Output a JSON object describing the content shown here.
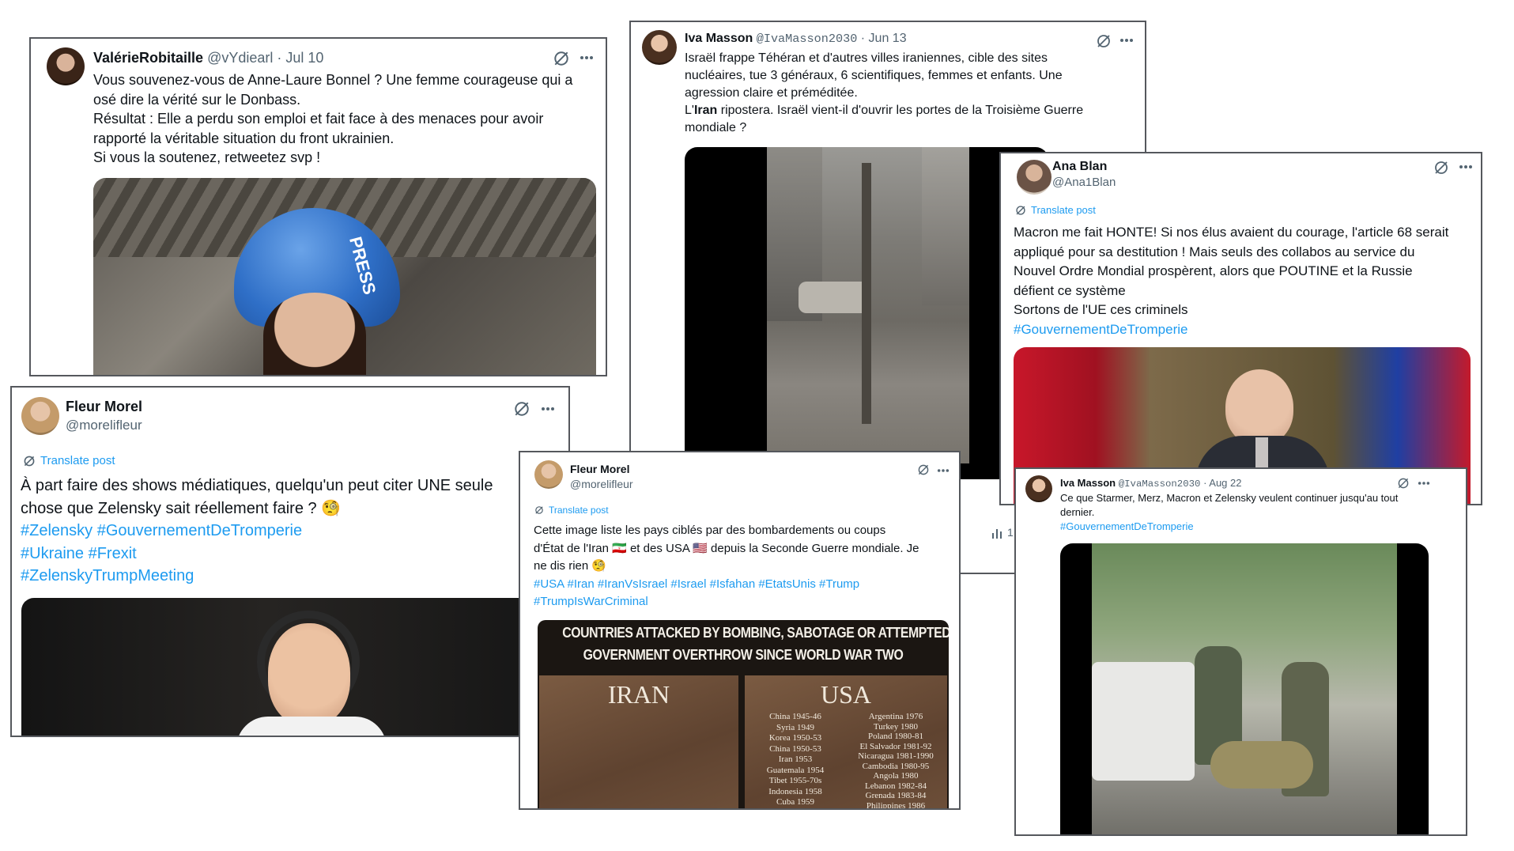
{
  "colors": {
    "link": "#1d9bf0",
    "muted": "#536471",
    "border": "#55585d"
  },
  "icons": {
    "grok": "grok-icon",
    "more": "more-icon",
    "translate": "translate-icon",
    "views": "views-icon"
  },
  "posts": [
    {
      "author": "ValérieRobitaille",
      "handle": "@vYdiearl",
      "date": "· Jul 10",
      "lines": [
        "Vous souvenez-vous de Anne-Laure Bonnel ?  Une femme courageuse qui a",
        "osé dire la vérité sur le Donbass.",
        "Résultat : Elle a perdu son emploi et fait face à des menaces pour avoir",
        "rapporté la véritable situation du front ukrainien.",
        "Si vous la soutenez, retweetez svp !"
      ],
      "media_text": "PRESS"
    },
    {
      "author": "Iva Masson",
      "handle": "@IvaMasson2030",
      "date": "· Jun 13",
      "lines": [
        "Israël frappe Téhéran et d'autres villes iraniennes, cible des sites",
        "nucléaires, tue 3 généraux, 6 scientifiques, femmes et enfants. Une",
        "agression claire et préméditée."
      ],
      "line4_prefix": "L'",
      "line4_bold": "Iran",
      "line4_rest": " ripostera. Israël vient-il d'ouvrir les portes de la Troisième Guerre",
      "line5": "mondiale ?",
      "views": "1"
    },
    {
      "author": "Ana Blan",
      "handle": "@Ana1Blan",
      "translate": "Translate post",
      "lines": [
        "Macron me fait HONTE! Si nos élus avaient du courage, l'article 68 serait",
        "appliqué pour sa destitution ! Mais seuls des collabos au service du",
        "Nouvel Ordre Mondial prospèrent, alors que POUTINE et la Russie",
        "défient ce système",
        "Sortons de l'UE ces criminels"
      ],
      "hashtags": "#GouvernementDeTromperie"
    },
    {
      "author": "Fleur Morel",
      "handle": "@morelifleur",
      "translate": "Translate post",
      "lines": [
        "À part faire des shows médiatiques, quelqu'un peut citer UNE seule",
        "chose que Zelensky sait réellement faire ? 🧐"
      ],
      "hashtag_lines": [
        "#Zelensky #GouvernementDeTromperie",
        "#Ukraine #Frexit",
        "#ZelenskyTrumpMeeting"
      ]
    },
    {
      "author": "Fleur Morel",
      "handle": "@morelifleur",
      "translate": "Translate post",
      "lines": [
        "Cette image liste les pays ciblés par des bombardements ou coups",
        "d'État de l'Iran 🇮🇷 et des USA 🇺🇸 depuis la Seconde Guerre mondiale. Je",
        "ne dis rien 🧐"
      ],
      "hashtag_lines": [
        "#USA #Iran #IranVsIsrael #Israel #Isfahan #EtatsUnis #Trump",
        "#TrumpIsWarCriminal"
      ],
      "poster": {
        "headline1": "COUNTRIES ATTACKED BY BOMBING, SABOTAGE  OR ATTEMPTED",
        "headline2": "GOVERNMENT OVERTHROW SINCE WORLD WAR TWO",
        "left_title": "IRAN",
        "right_title": "USA",
        "col1": [
          "China 1945-46",
          "Syria 1949",
          "Korea 1950-53",
          "China 1950-53",
          "Iran 1953",
          "Guatemala 1954",
          "Tibet 1955-70s",
          "Indonesia 1958",
          "Cuba 1959"
        ],
        "col2": [
          "Argentina 1976",
          "Turkey 1980",
          "Poland 1980-81",
          "El Salvador 1981-92",
          "Nicaragua 1981-1990",
          "Cambodia 1980-95",
          "Angola 1980",
          "Lebanon 1982-84",
          "Grenada 1983-84",
          "Philippines 1986"
        ]
      }
    },
    {
      "author": "Iva Masson",
      "handle": "@IvaMasson2030",
      "date": "· Aug 22",
      "lines": [
        "Ce que Starmer, Merz, Macron et Zelensky veulent continuer jusqu'au tout",
        "dernier."
      ],
      "hashtags": "#GouvernementDeTromperie"
    }
  ]
}
